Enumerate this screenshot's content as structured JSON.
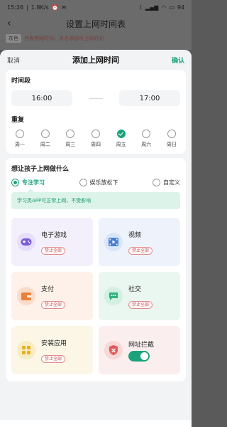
{
  "status_bar": {
    "time": "15:26",
    "net_speed": "1.8K/s",
    "battery": "94"
  },
  "background": {
    "title": "设置上网时间表",
    "legend_tag": "灰色",
    "legend_hint": "代表禁网时间，点击添加可上网时间"
  },
  "sheet": {
    "cancel_label": "取消",
    "title": "添加上网时间",
    "confirm_label": "确认",
    "period": {
      "title": "时间段",
      "start": "16:00",
      "end": "17:00"
    },
    "repeat": {
      "title": "重复",
      "days": [
        {
          "label": "周一",
          "checked": false
        },
        {
          "label": "周二",
          "checked": false
        },
        {
          "label": "周三",
          "checked": false
        },
        {
          "label": "周四",
          "checked": false
        },
        {
          "label": "周五",
          "checked": true
        },
        {
          "label": "周六",
          "checked": false
        },
        {
          "label": "周日",
          "checked": false
        }
      ]
    },
    "purpose": {
      "title": "想让孩子上网做什么",
      "modes": [
        {
          "label": "专注学习",
          "selected": true
        },
        {
          "label": "娱乐放松下",
          "selected": false
        },
        {
          "label": "自定义",
          "selected": false
        }
      ],
      "notice": "学习类APP可正常上网，不受影响"
    },
    "categories": [
      {
        "name": "电子游戏",
        "badge": "禁止全部",
        "icon": "gamepad-icon",
        "color": "#7b5bd6"
      },
      {
        "name": "视频",
        "badge": "禁止全部",
        "icon": "video-icon",
        "color": "#4a7fd4"
      },
      {
        "name": "支付",
        "badge": "禁止全部",
        "icon": "wallet-icon",
        "color": "#e8823a"
      },
      {
        "name": "社交",
        "badge": "禁止全部",
        "icon": "chat-icon",
        "color": "#2fb37a"
      },
      {
        "name": "安装应用",
        "badge": "禁止全部",
        "icon": "apps-icon",
        "color": "#e8b020"
      },
      {
        "name": "网址拦截",
        "toggle_on": true,
        "icon": "shield-icon",
        "color": "#e05a5a"
      }
    ]
  }
}
